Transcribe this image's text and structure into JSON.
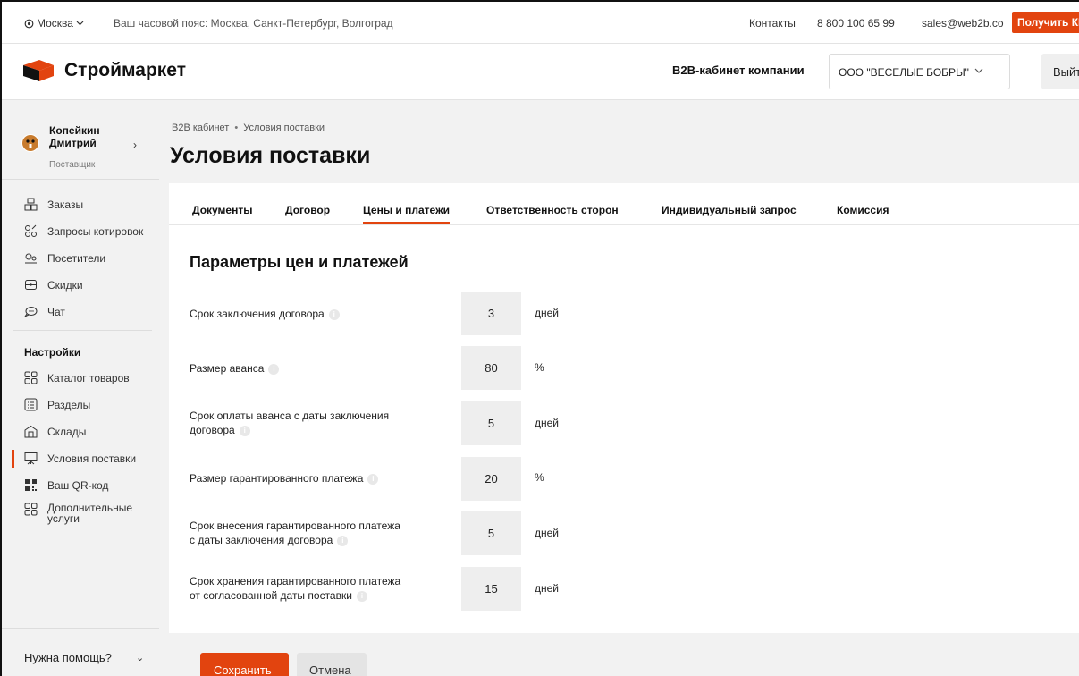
{
  "topbar": {
    "city": "Москва",
    "timezone": "Ваш часовой пояс: Москва, Санкт-Петербург, Волгоград",
    "contacts": "Контакты",
    "phone": "8 800 100 65 99",
    "email": "sales@web2b.co",
    "cta": "Получить КП"
  },
  "header": {
    "logo": "Строймаркет",
    "b2b_title": "B2B-кабинет компании",
    "company": "ООО \"ВЕСЕЛЫЕ БОБРЫ\"",
    "logout": "Выйти"
  },
  "user": {
    "first_line": "Копейкин",
    "second_line": "Дмитрий",
    "role": "Поставщик"
  },
  "sidebar": {
    "main_items": [
      {
        "label": "Заказы",
        "icon": "boxes-icon"
      },
      {
        "label": "Запросы котировок",
        "icon": "quotes-icon"
      },
      {
        "label": "Посетители",
        "icon": "visitors-icon"
      },
      {
        "label": "Скидки",
        "icon": "discount-icon"
      },
      {
        "label": "Чат",
        "icon": "chat-icon"
      }
    ],
    "settings_title": "Настройки",
    "settings_items": [
      {
        "label": "Каталог товаров",
        "icon": "grid-icon"
      },
      {
        "label": "Разделы",
        "icon": "list-icon"
      },
      {
        "label": "Склады",
        "icon": "warehouse-icon"
      },
      {
        "label": "Условия поставки",
        "icon": "board-icon"
      },
      {
        "label": "Ваш QR-код",
        "icon": "qr-icon"
      },
      {
        "label_line1": "Дополнительные",
        "label_line2": "услуги",
        "icon": "grid-icon"
      }
    ],
    "help": "Нужна помощь?"
  },
  "breadcrumb": {
    "root": "B2B кабинет",
    "current": "Условия поставки"
  },
  "page_title": "Условия поставки",
  "tabs": [
    "Документы",
    "Договор",
    "Цены и платежи",
    "Ответственность сторон",
    "Индивидуальный запрос",
    "Комиссия"
  ],
  "active_tab": "Цены и платежи",
  "section_title": "Параметры цен и платежей",
  "params": [
    {
      "line1": "Срок заключения договора",
      "line2": "",
      "value": "3",
      "unit": "дней"
    },
    {
      "line1": "Размер аванса",
      "line2": "",
      "value": "80",
      "unit": "%"
    },
    {
      "line1": "Срок оплаты аванса с даты заключения",
      "line2": "договора",
      "value": "5",
      "unit": "дней"
    },
    {
      "line1": "Размер гарантированного платежа",
      "line2": "",
      "value": "20",
      "unit": "%"
    },
    {
      "line1": "Срок внесения гарантированного платежа",
      "line2": "с даты заключения договора",
      "value": "5",
      "unit": "дней"
    },
    {
      "line1": "Срок хранения гарантированного платежа",
      "line2": "от согласованной даты поставки",
      "value": "15",
      "unit": "дней"
    }
  ],
  "buttons": {
    "save": "Сохранить",
    "cancel": "Отмена"
  },
  "colors": {
    "accent": "#e2440f",
    "background": "#f2f2f2",
    "field": "#eeeeee"
  }
}
